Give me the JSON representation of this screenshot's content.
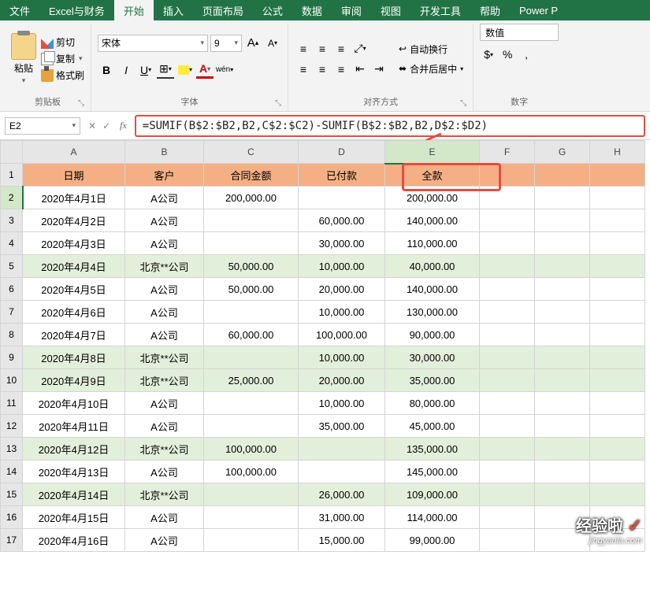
{
  "ribbon": {
    "tabs": [
      "文件",
      "Excel与财务",
      "开始",
      "插入",
      "页面布局",
      "公式",
      "数据",
      "审阅",
      "视图",
      "开发工具",
      "帮助",
      "Power P"
    ],
    "active_tab_index": 2,
    "clipboard": {
      "paste": "粘贴",
      "cut": "剪切",
      "copy": "复制",
      "brush": "格式刷",
      "title": "剪贴板"
    },
    "font": {
      "name": "宋体",
      "size": "9",
      "title": "字体",
      "wen": "wén"
    },
    "align": {
      "wrap": "自动换行",
      "merge": "合并后居中",
      "title": "对齐方式"
    },
    "number": {
      "format": "数值",
      "title": "数字"
    }
  },
  "name_box": "E2",
  "formula": "=SUMIF(B$2:$B2,B2,C$2:$C2)-SUMIF(B$2:$B2,B2,D$2:$D2)",
  "columns": [
    "A",
    "B",
    "C",
    "D",
    "E",
    "F",
    "G",
    "H"
  ],
  "headers": {
    "A": "日期",
    "B": "客户",
    "C": "合同金额",
    "D": "已付款",
    "E": "全款"
  },
  "rows": [
    {
      "n": 1,
      "hdr": true
    },
    {
      "n": 2,
      "A": "2020年4月1日",
      "B": "A公司",
      "C": "200,000.00",
      "D": "",
      "E": "200,000.00"
    },
    {
      "n": 3,
      "A": "2020年4月2日",
      "B": "A公司",
      "C": "",
      "D": "60,000.00",
      "E": "140,000.00"
    },
    {
      "n": 4,
      "A": "2020年4月3日",
      "B": "A公司",
      "C": "",
      "D": "30,000.00",
      "E": "110,000.00"
    },
    {
      "n": 5,
      "alt": true,
      "A": "2020年4月4日",
      "B": "北京**公司",
      "C": "50,000.00",
      "D": "10,000.00",
      "E": "40,000.00"
    },
    {
      "n": 6,
      "A": "2020年4月5日",
      "B": "A公司",
      "C": "50,000.00",
      "D": "20,000.00",
      "E": "140,000.00"
    },
    {
      "n": 7,
      "A": "2020年4月6日",
      "B": "A公司",
      "C": "",
      "D": "10,000.00",
      "E": "130,000.00"
    },
    {
      "n": 8,
      "A": "2020年4月7日",
      "B": "A公司",
      "C": "60,000.00",
      "D": "100,000.00",
      "E": "90,000.00"
    },
    {
      "n": 9,
      "alt": true,
      "A": "2020年4月8日",
      "B": "北京**公司",
      "C": "",
      "D": "10,000.00",
      "E": "30,000.00"
    },
    {
      "n": 10,
      "alt": true,
      "A": "2020年4月9日",
      "B": "北京**公司",
      "C": "25,000.00",
      "D": "20,000.00",
      "E": "35,000.00"
    },
    {
      "n": 11,
      "A": "2020年4月10日",
      "B": "A公司",
      "C": "",
      "D": "10,000.00",
      "E": "80,000.00"
    },
    {
      "n": 12,
      "A": "2020年4月11日",
      "B": "A公司",
      "C": "",
      "D": "35,000.00",
      "E": "45,000.00"
    },
    {
      "n": 13,
      "alt": true,
      "A": "2020年4月12日",
      "B": "北京**公司",
      "C": "100,000.00",
      "D": "",
      "E": "135,000.00"
    },
    {
      "n": 14,
      "A": "2020年4月13日",
      "B": "A公司",
      "C": "100,000.00",
      "D": "",
      "E": "145,000.00"
    },
    {
      "n": 15,
      "alt": true,
      "A": "2020年4月14日",
      "B": "北京**公司",
      "C": "",
      "D": "26,000.00",
      "E": "109,000.00"
    },
    {
      "n": 16,
      "A": "2020年4月15日",
      "B": "A公司",
      "C": "",
      "D": "31,000.00",
      "E": "114,000.00"
    },
    {
      "n": 17,
      "A": "2020年4月16日",
      "B": "A公司",
      "C": "",
      "D": "15,000.00",
      "E": "99,000.00"
    }
  ],
  "watermark": {
    "line1": "经验啦",
    "line2": "jingyanla.com"
  }
}
